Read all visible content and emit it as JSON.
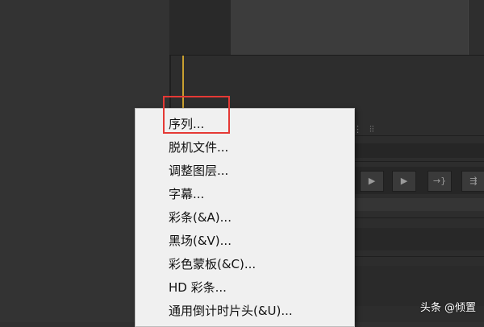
{
  "menu": {
    "items": [
      {
        "label": "序列..."
      },
      {
        "label": "脱机文件..."
      },
      {
        "label": "调整图层..."
      },
      {
        "label": "字幕..."
      },
      {
        "label": "彩条(&A)..."
      },
      {
        "label": "黑场(&V)..."
      },
      {
        "label": "彩色蒙板(&C)..."
      },
      {
        "label": "HD 彩条..."
      },
      {
        "label": "通用倒计时片头(&U)..."
      }
    ],
    "highlighted_item": "序列..."
  },
  "toolbar": {
    "play_icon": "▶",
    "step_icon": "▶",
    "insert_icon": "→}",
    "overwrite_icon": "⇶"
  },
  "watermark": {
    "text": "头条 @倾置"
  },
  "colors": {
    "highlight_border": "#e53935",
    "playhead": "#c8a030",
    "menu_background": "#f0f0f0"
  }
}
